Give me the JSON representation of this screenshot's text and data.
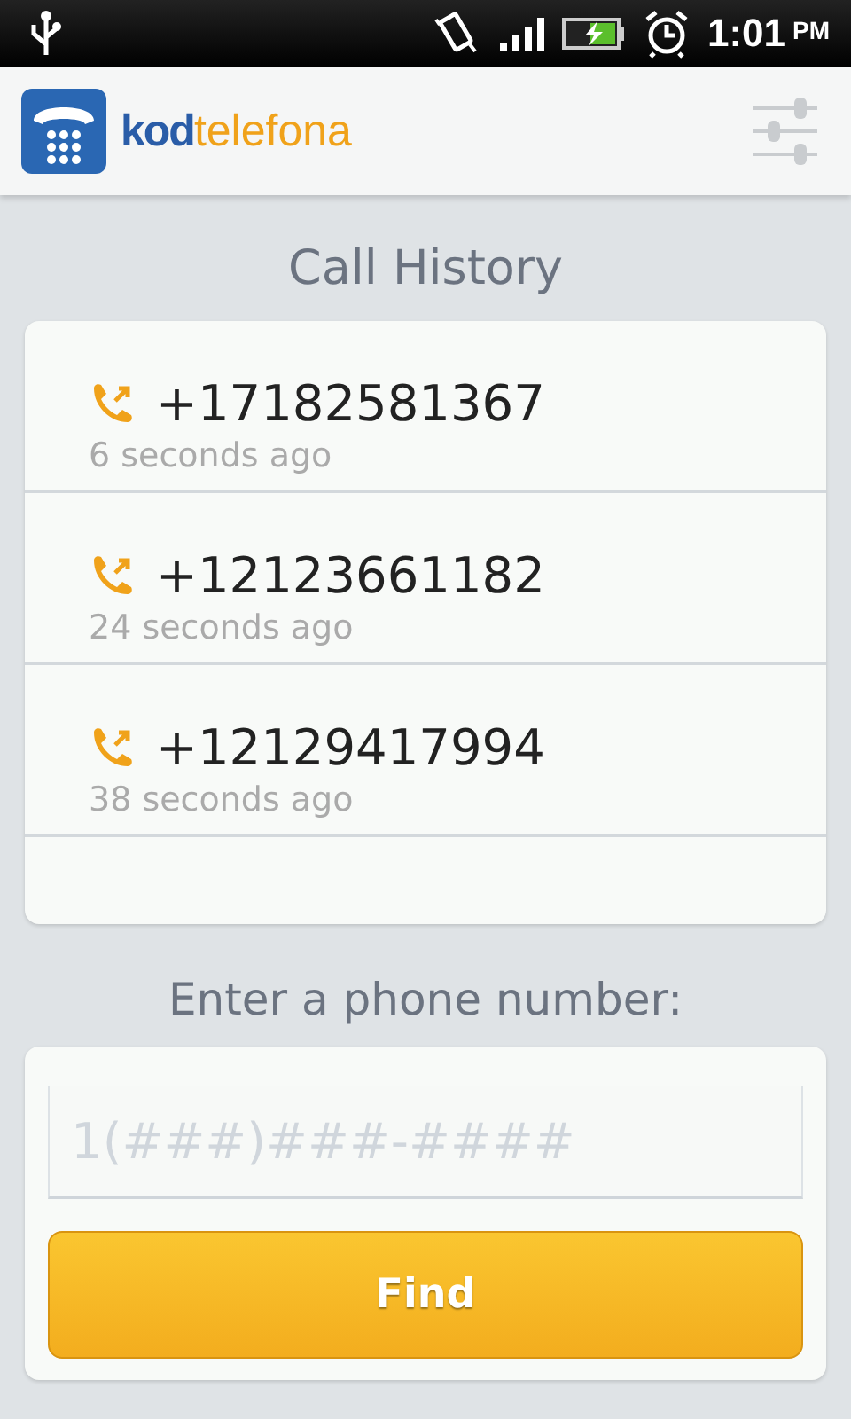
{
  "status_bar": {
    "time": "1:01",
    "meridiem": "PM"
  },
  "app_bar": {
    "logo_bold": "kod",
    "logo_light": "telefona"
  },
  "history": {
    "title": "Call History",
    "calls": [
      {
        "number": "+17182581367",
        "ago": "6 seconds ago"
      },
      {
        "number": "+12123661182",
        "ago": "24 seconds ago"
      },
      {
        "number": "+12129417994",
        "ago": "38 seconds ago"
      }
    ]
  },
  "lookup": {
    "label": "Enter a phone number:",
    "placeholder": "1(###)###-####",
    "button": "Find"
  }
}
